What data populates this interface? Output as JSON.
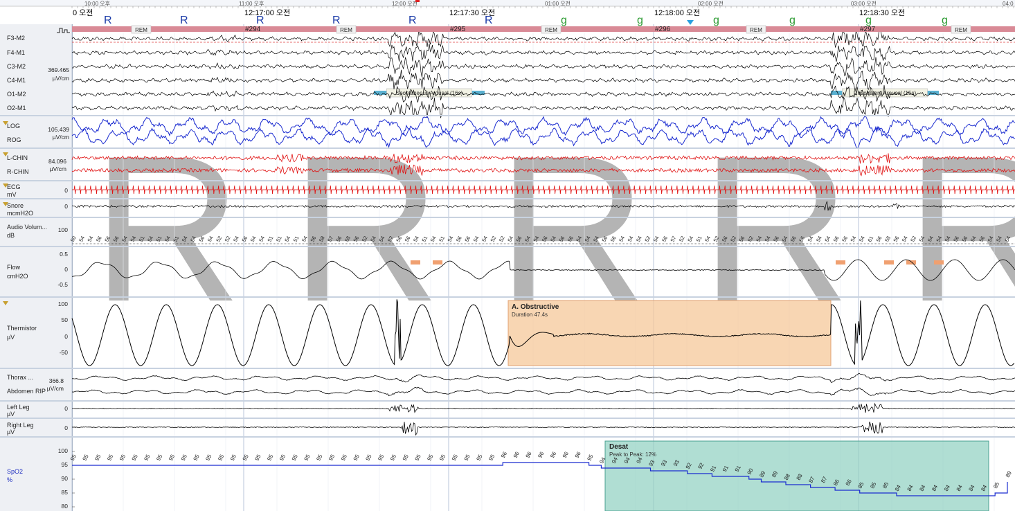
{
  "top_ruler": {
    "fine_labels": [
      "10:00 오후",
      "11:00 오후",
      "12:00 오전",
      "01:00 오전",
      "02:00 오전",
      "03:00 오전",
      "04:0"
    ],
    "main_times": [
      "0 오전",
      "12:17:00 오전",
      "12:17:30 오전",
      "12:18:00 오전",
      "12:18:30 오전"
    ],
    "epochs": [
      "#294",
      "#295",
      "#296",
      "#297"
    ],
    "stage_label": "REM"
  },
  "channels": {
    "eeg": {
      "names": [
        "F3-M2",
        "F4-M1",
        "C3-M2",
        "C4-M1",
        "O1-M2",
        "O2-M1"
      ],
      "scale": "369.465",
      "unit": "µV/cm"
    },
    "eog": {
      "names": [
        "LOG",
        "ROG"
      ],
      "scale": "105.439",
      "unit": "µV/cm"
    },
    "chin": {
      "names": [
        "L-CHIN",
        "R-CHIN"
      ],
      "scale": "84.096",
      "unit": "µV/cm"
    },
    "ecg": {
      "name": "ECG",
      "unit": "mV",
      "scale": "0"
    },
    "snore": {
      "name": "Snore",
      "unit": "mcmH2O",
      "scale": "0"
    },
    "audio": {
      "name": "Audio Volum...",
      "unit": "dB",
      "scale": "100"
    },
    "flow": {
      "name": "Flow",
      "unit": "cmH2O",
      "ticks": [
        "0.5",
        "0",
        "-0.5"
      ]
    },
    "thermistor": {
      "name": "Thermistor",
      "unit": "µV",
      "ticks": [
        "100",
        "50",
        "0",
        "-50"
      ]
    },
    "rip": {
      "names": [
        "Thorax ...",
        "Abdomen RIP"
      ],
      "scale": "366.8",
      "unit": "µV/cm"
    },
    "left_leg": {
      "name": "Left Leg",
      "unit": "µV",
      "scale": "0"
    },
    "right_leg": {
      "name": "Right Leg",
      "unit": "µV",
      "scale": "0"
    },
    "spo2": {
      "name": "SpO2",
      "unit": "%",
      "ticks": [
        "100",
        "95",
        "90",
        "85",
        "80"
      ]
    }
  },
  "events": {
    "arousal1": "Spontaneous Arousal (16s)",
    "arousal2": "Respiratory Arousal (15s)",
    "apnea_title": "A. Obstructive",
    "apnea_duration": "Duration 47.4s",
    "desat_title": "Desat",
    "desat_detail": "Peak to Peak: 12%"
  },
  "audio_values": [
    "50",
    "54",
    "54",
    "56",
    "56",
    "56",
    "54",
    "54",
    "51",
    "54",
    "51",
    "54",
    "51",
    "54",
    "54",
    "56",
    "54",
    "52",
    "52",
    "54",
    "56",
    "54",
    "54",
    "51",
    "51",
    "54",
    "51",
    "54",
    "56",
    "58",
    "57",
    "56",
    "58",
    "56",
    "52",
    "54",
    "54",
    "52",
    "56",
    "56",
    "54",
    "51",
    "54",
    "51",
    "54",
    "56",
    "56",
    "54",
    "54",
    "52",
    "52",
    "54",
    "56",
    "54",
    "54",
    "56",
    "54",
    "56",
    "56",
    "54",
    "54",
    "54",
    "56",
    "56",
    "54",
    "54",
    "54",
    "52",
    "54",
    "56",
    "57",
    "52",
    "54",
    "51",
    "54",
    "52",
    "56",
    "52",
    "56",
    "52",
    "54",
    "54",
    "56",
    "54",
    "56",
    "56",
    "54",
    "54",
    "54",
    "56",
    "56",
    "54",
    "54",
    "61",
    "56",
    "58",
    "56",
    "54",
    "52",
    "54",
    "54",
    "54",
    "54",
    "56",
    "56",
    "54",
    "56",
    "54",
    "54",
    "54"
  ],
  "chart_data": {
    "type": "line",
    "title": "",
    "xlabel": "",
    "ylabel": "SpO2 %",
    "ylim": [
      80,
      100
    ],
    "yticks": [
      100,
      95,
      90,
      85,
      80
    ],
    "series": [
      {
        "name": "SpO2",
        "values": [
          95,
          95,
          95,
          95,
          95,
          95,
          95,
          95,
          95,
          95,
          95,
          95,
          95,
          95,
          95,
          95,
          95,
          95,
          95,
          95,
          95,
          95,
          95,
          95,
          95,
          95,
          95,
          95,
          95,
          95,
          95,
          95,
          95,
          95,
          95,
          96,
          96,
          96,
          96,
          96,
          96,
          96,
          95,
          94,
          94,
          94,
          94,
          93,
          93,
          93,
          92,
          92,
          91,
          91,
          91,
          90,
          89,
          89,
          88,
          88,
          87,
          87,
          86,
          86,
          85,
          85,
          85,
          84,
          84,
          84,
          84,
          84,
          84,
          84,
          84,
          85,
          89
        ]
      }
    ]
  }
}
